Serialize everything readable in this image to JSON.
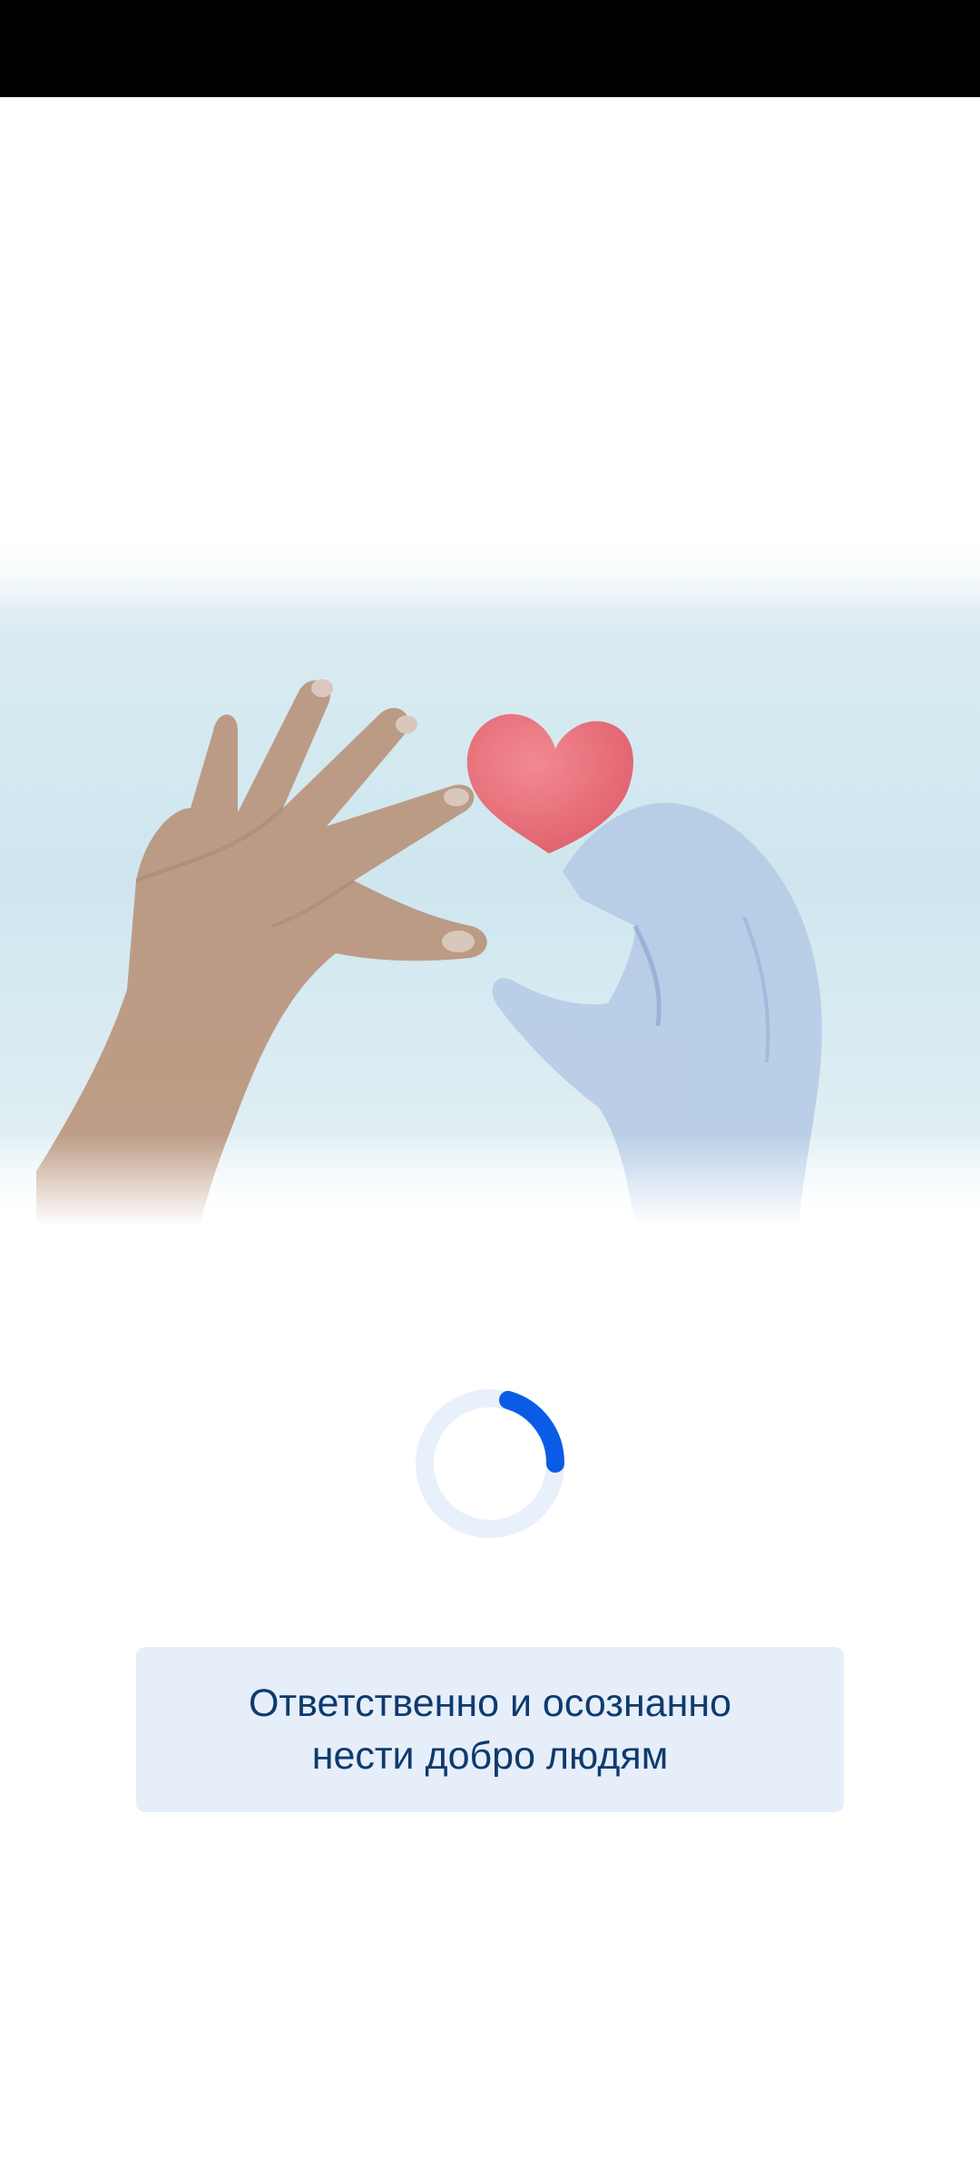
{
  "app": {
    "screen": "splash"
  },
  "hero": {
    "illustration": "hands-holding-heart-image"
  },
  "loader": {
    "icon": "loading-spinner-icon",
    "track_color": "#e8f0fb",
    "arc_color": "#0a5ce6"
  },
  "slogan": {
    "text": "Ответственно и осознанно\nнести добро людям",
    "background": "#e6eef9",
    "color": "#0e3a6e"
  }
}
